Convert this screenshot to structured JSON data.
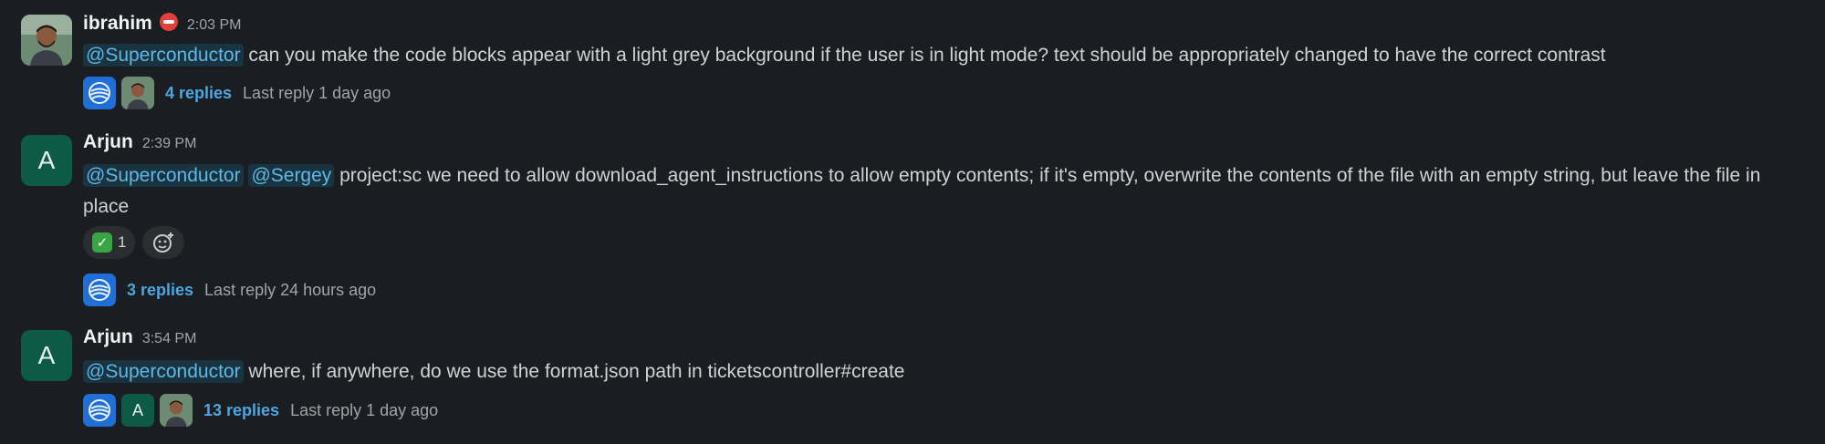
{
  "messages": [
    {
      "author": "ibrahim",
      "status_icon": "do-not-disturb-icon",
      "time": "2:03 PM",
      "mentions": [
        "@Superconductor"
      ],
      "text": " can you make the code blocks appear with a light grey background if the user is in light mode? text should be appropriately changed to have the correct contrast",
      "thread": {
        "replies": "4 replies",
        "last_reply": "Last reply 1 day ago"
      }
    },
    {
      "author": "Arjun",
      "avatar_letter": "A",
      "time": "2:39 PM",
      "mentions": [
        "@Superconductor",
        "@Sergey"
      ],
      "text": " project:sc we need to allow download_agent_instructions to allow empty contents; if it's empty, overwrite the contents of the file with an empty string, but leave the file in place",
      "reactions": [
        {
          "emoji": "white-check-mark-icon",
          "count": "1"
        }
      ],
      "thread": {
        "replies": "3 replies",
        "last_reply": "Last reply 24 hours ago"
      }
    },
    {
      "author": "Arjun",
      "avatar_letter": "A",
      "time": "3:54 PM",
      "mentions": [
        "@Superconductor"
      ],
      "text": " where, if anywhere, do we use the format.json path in ticketscontroller#create",
      "thread": {
        "participant_letter": "A",
        "replies": "13 replies",
        "last_reply": "Last reply 1 day ago"
      }
    }
  ],
  "colors": {
    "background": "#1a1d21",
    "mention_text": "#5fb8e6",
    "link": "#4ea6e0",
    "avatar_green": "#0d5a48"
  }
}
